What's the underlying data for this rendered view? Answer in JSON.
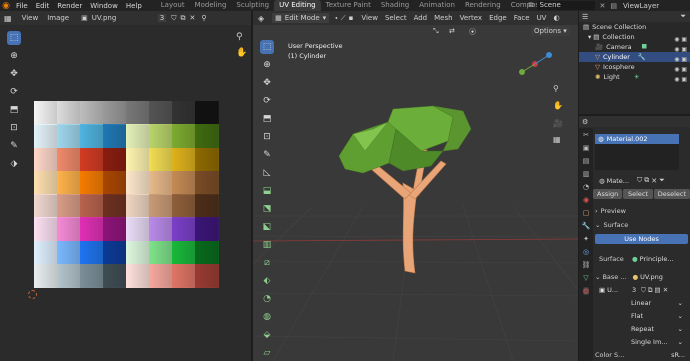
{
  "topbar": {
    "menus": [
      "File",
      "Edit",
      "Render",
      "Window",
      "Help"
    ],
    "tabs": [
      "Layout",
      "Modeling",
      "Sculpting",
      "UV Editing",
      "Texture Paint",
      "Shading",
      "Animation",
      "Rendering",
      "Compositin"
    ],
    "active_tab": "UV Editing",
    "scene_name": "Scene",
    "view_layer": "ViewLayer"
  },
  "uv_editor": {
    "view_menu": "View",
    "image_menu": "Image",
    "image_name": "UV.png",
    "users": "3"
  },
  "viewport": {
    "mode": "Edit Mode",
    "menus": [
      "View",
      "Select",
      "Add",
      "Mesh",
      "Vertex",
      "Edge",
      "Face",
      "UV"
    ],
    "options_label": "Options",
    "view_name": "User Perspective",
    "object_name": "(1) Cylinder"
  },
  "outliner": {
    "root": "Scene Collection",
    "collection": "Collection",
    "items": [
      "Camera",
      "Cylinder",
      "Icosphere",
      "Light"
    ],
    "selected": "Cylinder"
  },
  "properties": {
    "material_slot": "Material.002",
    "material_name": "Mate...",
    "assign": "Assign",
    "select": "Select",
    "deselect": "Deselect",
    "preview": "Preview",
    "surface_header": "Surface",
    "use_nodes": "Use Nodes",
    "surface_label": "Surface",
    "surface_value": "Principle...",
    "base_label": "Base ...",
    "base_value": "UV.png",
    "image_users": "3",
    "u_label": "U...",
    "interp": "Linear",
    "projection": "Flat",
    "extension": "Repeat",
    "source": "Single Im...",
    "color_space_label": "Color S...",
    "color_space_value": "sR..."
  },
  "colors": {
    "accent": "#4772b3",
    "active_tab": "#3a3a3a",
    "foliage": "#5f9f32",
    "trunk": "#e8a678"
  },
  "palette": [
    [
      "#f5f5f5",
      "#dcdcdc",
      "#bdbdbd",
      "#9a9a9a",
      "#787878",
      "#545454",
      "#333333",
      "#111111"
    ],
    [
      "#e3f3fa",
      "#9fd7ee",
      "#4fb4e0",
      "#1f78b4",
      "#e4f0b8",
      "#b9d56a",
      "#7cab2f",
      "#3f6b10"
    ],
    [
      "#ffd7c8",
      "#f08a6a",
      "#d23b22",
      "#8a1c10",
      "#fff5b0",
      "#f3dd52",
      "#dfb21b",
      "#8f6a00"
    ],
    [
      "#ffe0b0",
      "#ffb34a",
      "#f57c00",
      "#a94600",
      "#fde7cc",
      "#e8b98a",
      "#c58a55",
      "#7a4c26"
    ],
    [
      "#f0d8cf",
      "#d99d88",
      "#b8634d",
      "#6d3020",
      "#f0d6c2",
      "#c99b75",
      "#8f5f3a",
      "#4d2e18"
    ],
    [
      "#fde0f3",
      "#f58ad6",
      "#e02fb5",
      "#8d137a",
      "#eadcf7",
      "#b98ae8",
      "#7b3fc9",
      "#3b1578"
    ],
    [
      "#dff0ff",
      "#7ab8ff",
      "#1e74f0",
      "#0b3a96",
      "#ddf8df",
      "#7ee38a",
      "#19b83a",
      "#076b1b"
    ],
    [
      "#e8eef1",
      "#b5c5cd",
      "#7b8f99",
      "#3f4d54",
      "#ffe0dc",
      "#f7a89e",
      "#e07566",
      "#9a3b33"
    ]
  ]
}
